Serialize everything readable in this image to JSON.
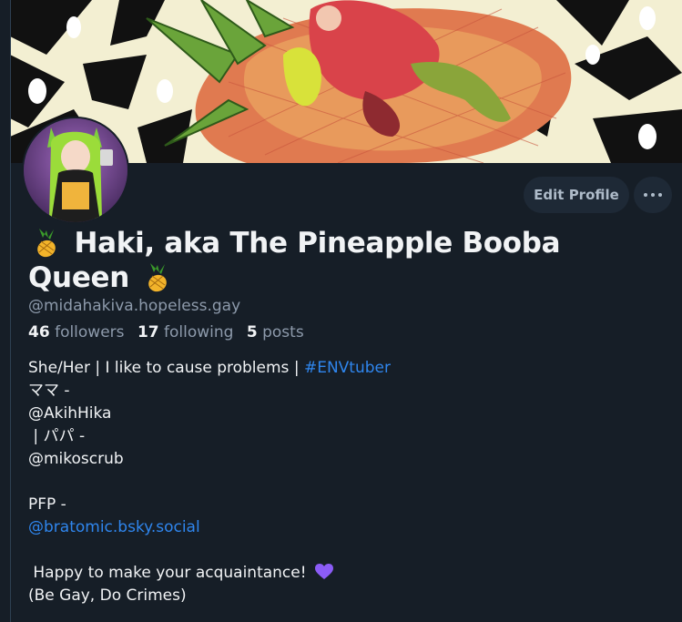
{
  "profile": {
    "display_name": "Haki, aka The Pineapple Booba Queen",
    "handle": "@midahakiva.hopeless.gay",
    "stats": {
      "followers_count": "46",
      "followers_label": "followers",
      "following_count": "17",
      "following_label": "following",
      "posts_count": "5",
      "posts_label": "posts"
    }
  },
  "actions": {
    "edit_profile_label": "Edit Profile",
    "more_icon": "ellipsis-icon"
  },
  "bio": {
    "line1_text": "She/Her | I like to cause problems | ",
    "line1_hashtag": "#ENVtuber",
    "line2": "ママ -",
    "line3": "@AkihHika",
    "line4": " | パパ -",
    "line5": "@mikoscrub",
    "line7": "PFP -",
    "line8_link": "@bratomic.bsky.social",
    "line10_text": " Happy to make your acquaintance! ",
    "line11": "(Be Gay, Do Crimes)"
  },
  "colors": {
    "background": "#161e27",
    "accent_link": "#2f86ee",
    "muted_text": "#8d9aab",
    "button_bg": "#1e2936",
    "heart": "#8b5cf6"
  },
  "icons": {
    "name_prefix": "pineapple-icon",
    "name_suffix": "pineapple-icon",
    "bio_heart": "purple-heart-icon"
  }
}
